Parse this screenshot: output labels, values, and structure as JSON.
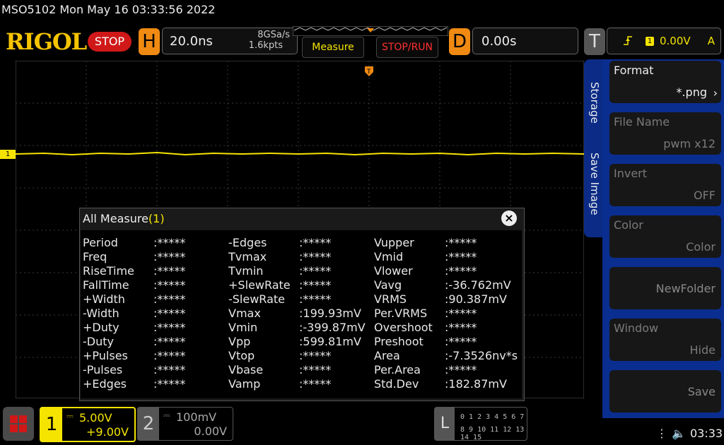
{
  "status_line": "MSO5102  Mon May 16 03:33:56 2022",
  "logo": "RIGOL",
  "run_state": "STOP",
  "horizontal": {
    "letter": "H",
    "timebase": "20.0ns",
    "sample_rate": "8GSa/s",
    "memory_depth": "1.6kpts"
  },
  "buttons": {
    "measure": "Measure",
    "stop_run": "STOP/RUN"
  },
  "delay": {
    "letter": "D",
    "value": "0.00s"
  },
  "trigger": {
    "letter": "T",
    "source": "1",
    "level": "0.00V",
    "mode": "A"
  },
  "channel_marker": "1",
  "side_menu": {
    "tabs": [
      "Storage",
      "Save Image"
    ],
    "items": [
      {
        "name": "Format",
        "value": "*.png"
      },
      {
        "name": "File Name",
        "value": "pwm x12"
      },
      {
        "name": "Invert",
        "value": "OFF"
      },
      {
        "name": "Color",
        "value": "Color"
      },
      {
        "name": "",
        "value": "NewFolder"
      },
      {
        "name": "Window",
        "value": "Hide"
      },
      {
        "name": "",
        "value": "Save"
      }
    ]
  },
  "measure_dialog": {
    "title": "All Measure",
    "count": "(1)",
    "columns": [
      [
        {
          "label": "Period",
          "value": ":*****"
        },
        {
          "label": "Freq",
          "value": ":*****"
        },
        {
          "label": "RiseTime",
          "value": ":*****"
        },
        {
          "label": "FallTime",
          "value": ":*****"
        },
        {
          "label": "+Width",
          "value": ":*****"
        },
        {
          "label": "-Width",
          "value": ":*****"
        },
        {
          "label": "+Duty",
          "value": ":*****"
        },
        {
          "label": "-Duty",
          "value": ":*****"
        },
        {
          "label": "+Pulses",
          "value": ":*****"
        },
        {
          "label": "-Pulses",
          "value": ":*****"
        },
        {
          "label": "+Edges",
          "value": ":*****"
        }
      ],
      [
        {
          "label": "-Edges",
          "value": ":*****"
        },
        {
          "label": "Tvmax",
          "value": ":*****"
        },
        {
          "label": "Tvmin",
          "value": ":*****"
        },
        {
          "label": "+SlewRate",
          "value": ":*****"
        },
        {
          "label": "-SlewRate",
          "value": ":*****"
        },
        {
          "label": "Vmax",
          "value": ":199.93mV"
        },
        {
          "label": "Vmin",
          "value": ":-399.87mV"
        },
        {
          "label": "Vpp",
          "value": ":599.81mV"
        },
        {
          "label": "Vtop",
          "value": ":*****"
        },
        {
          "label": "Vbase",
          "value": ":*****"
        },
        {
          "label": "Vamp",
          "value": ":*****"
        }
      ],
      [
        {
          "label": "Vupper",
          "value": ":*****"
        },
        {
          "label": "Vmid",
          "value": ":*****"
        },
        {
          "label": "Vlower",
          "value": ":*****"
        },
        {
          "label": "Vavg",
          "value": ":-36.762mV"
        },
        {
          "label": "VRMS",
          "value": ":90.387mV"
        },
        {
          "label": "Per.VRMS",
          "value": ":*****"
        },
        {
          "label": "Overshoot",
          "value": ":*****"
        },
        {
          "label": "Preshoot",
          "value": ":*****"
        },
        {
          "label": "Area",
          "value": ":-7.3526nv*s"
        },
        {
          "label": "Per.Area",
          "value": ":*****"
        },
        {
          "label": "Std.Dev",
          "value": ":182.87mV"
        }
      ]
    ]
  },
  "channels": [
    {
      "number": "1",
      "scale": "5.00V",
      "offset": "+9.00V",
      "color": "#f5e400"
    },
    {
      "number": "2",
      "scale": "100mV",
      "offset": "0.00V",
      "color": "#888888"
    }
  ],
  "logic": {
    "letter": "L",
    "row1": "0 1 2 3  4 5 6 7",
    "row2": "8 9 10 11 12 13 14 15"
  },
  "clock": "03:33",
  "colors": {
    "channel1": "#f5e400",
    "menu_blue": "#0a2e90",
    "stop_red": "#d01818",
    "accent_orange": "#f08a12"
  }
}
